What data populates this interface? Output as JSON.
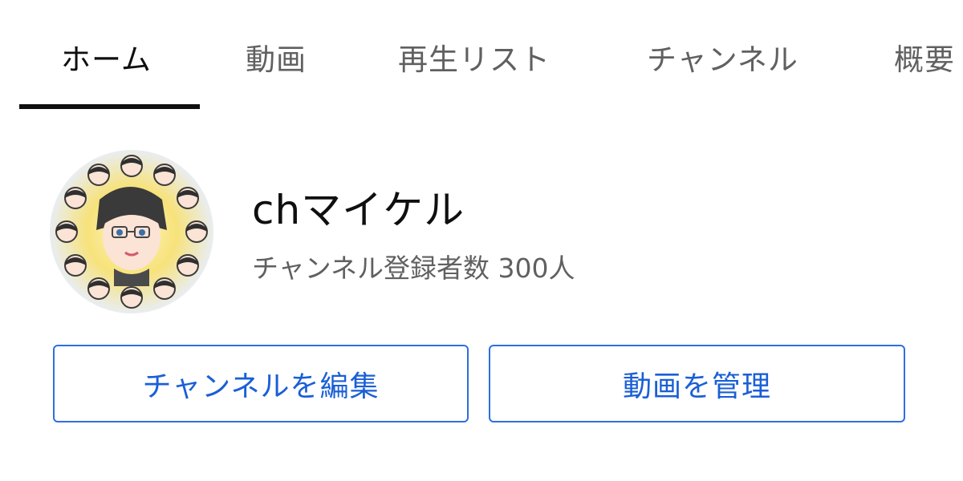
{
  "tabs": [
    {
      "label": "ホーム",
      "active": true
    },
    {
      "label": "動画",
      "active": false
    },
    {
      "label": "再生リスト",
      "active": false
    },
    {
      "label": "チャンネル",
      "active": false
    },
    {
      "label": "概要",
      "active": false
    }
  ],
  "channel": {
    "name": "chマイケル",
    "subscribers": "チャンネル登録者数 300人",
    "avatar_icon": "avatar-illustration-icon"
  },
  "actions": {
    "edit_channel_label": "チャンネルを編集",
    "manage_videos_label": "動画を管理"
  },
  "colors": {
    "accent_blue": "#1a5fd6",
    "active_tab_underline": "#0f0f0f",
    "inactive_tab_text": "#606060"
  }
}
